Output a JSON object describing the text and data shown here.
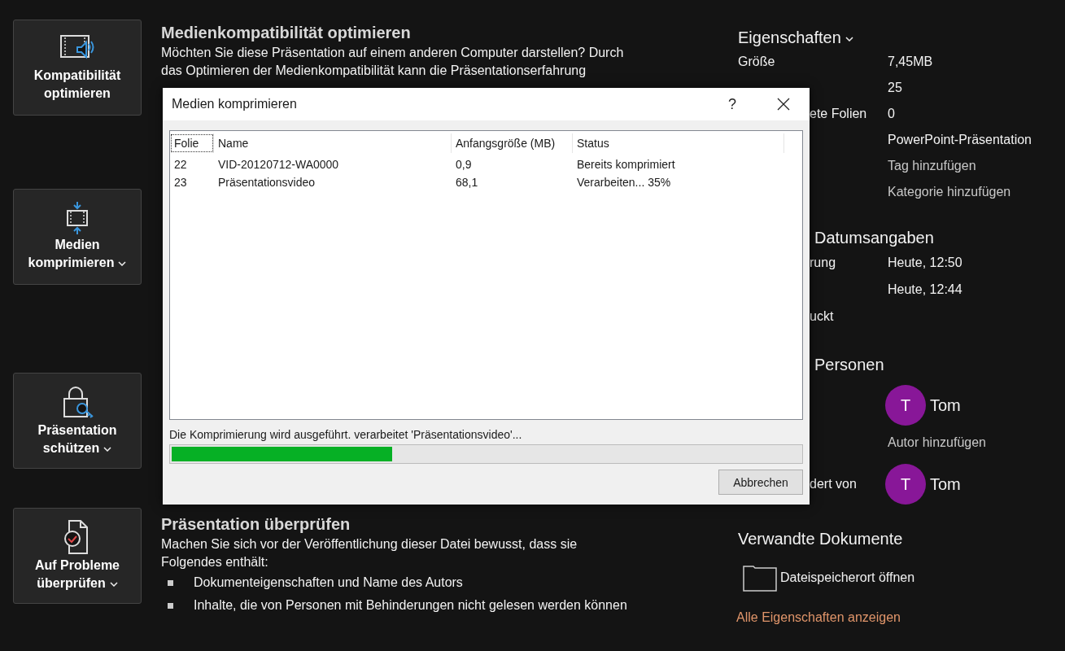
{
  "tools": [
    {
      "kind": "media-sound",
      "label": "Kompatibilität optimieren",
      "dropdown": false
    },
    {
      "kind": "media-compress",
      "label": "Medien komprimieren",
      "dropdown": true
    },
    {
      "kind": "lock-key",
      "label": "Präsentation schützen",
      "dropdown": true
    },
    {
      "kind": "doc-check",
      "label": "Auf Probleme überprüfen",
      "dropdown": true
    }
  ],
  "sections": [
    {
      "title": "Medienkompatibilität optimieren",
      "lines": [
        "Möchten Sie diese Präsentation auf einem anderen Computer darstellen? Durch",
        "das Optimieren der Medienkompatibilität kann die Präsentationserfahrung"
      ]
    },
    {
      "title": "Präsentation überprüfen",
      "lines": [
        "Machen Sie sich vor der Veröffentlichung dieser Datei bewusst, dass sie",
        "Folgendes enthält:"
      ],
      "bullets": [
        "Dokumenteigenschaften und Name des Autors",
        "Inhalte, die von Personen mit Behinderungen nicht gelesen werden können"
      ]
    }
  ],
  "properties": {
    "title": "Eigenschaften",
    "rows": [
      {
        "kind": "full",
        "label": "Größe",
        "value": "7,45MB",
        "editable": false
      },
      {
        "kind": "covered",
        "value": "25",
        "editable": false
      },
      {
        "kind": "covered",
        "label": "ete Folien",
        "value": "0",
        "editable": false
      },
      {
        "kind": "covered",
        "value": "PowerPoint-Präsentation",
        "editable": false
      },
      {
        "kind": "covered",
        "value": "Tag hinzufügen",
        "editable": true
      },
      {
        "kind": "covered",
        "value": "Kategorie hinzufügen",
        "editable": true
      }
    ]
  },
  "dates": {
    "title": "Datumsangaben",
    "rows": [
      {
        "kind": "covered",
        "label": "rung",
        "value": "Heute, 12:50",
        "editable": false
      },
      {
        "kind": "covered",
        "value": "Heute, 12:44",
        "editable": false
      },
      {
        "kind": "covered",
        "label": "uckt",
        "editable": false
      }
    ]
  },
  "people": {
    "title": "Personen",
    "rows": [
      {
        "kind": "person",
        "initial": "T",
        "name": "Tom"
      },
      {
        "kind": "link",
        "text": "Autor hinzufügen"
      },
      {
        "kind": "person",
        "label": "dert von",
        "initial": "T",
        "name": "Tom"
      }
    ]
  },
  "related": {
    "title": "Verwandte Dokumente",
    "items": [
      "Dateispeicherort öffnen"
    ],
    "link": "Alle Eigenschaften anzeigen"
  },
  "dialog": {
    "title": "Medien komprimieren",
    "help": "?",
    "columns": [
      {
        "label": "Folie",
        "focused": true
      },
      {
        "label": "Name",
        "focused": false
      },
      {
        "label": "Anfangsgröße (MB)",
        "focused": false
      },
      {
        "label": "Status",
        "focused": false
      }
    ],
    "rows": [
      [
        "22",
        "VID-20120712-WA0000",
        "0,9",
        "Bereits komprimiert"
      ],
      [
        "23",
        "Präsentationsvideo",
        "68,1",
        "Verarbeiten... 35%"
      ]
    ],
    "status_text": "Die Komprimierung wird ausgeführt. verarbeitet 'Präsentationsvideo'...",
    "progress": {
      "level": 0.35
    },
    "buttons": [
      "Abbrechen"
    ]
  }
}
